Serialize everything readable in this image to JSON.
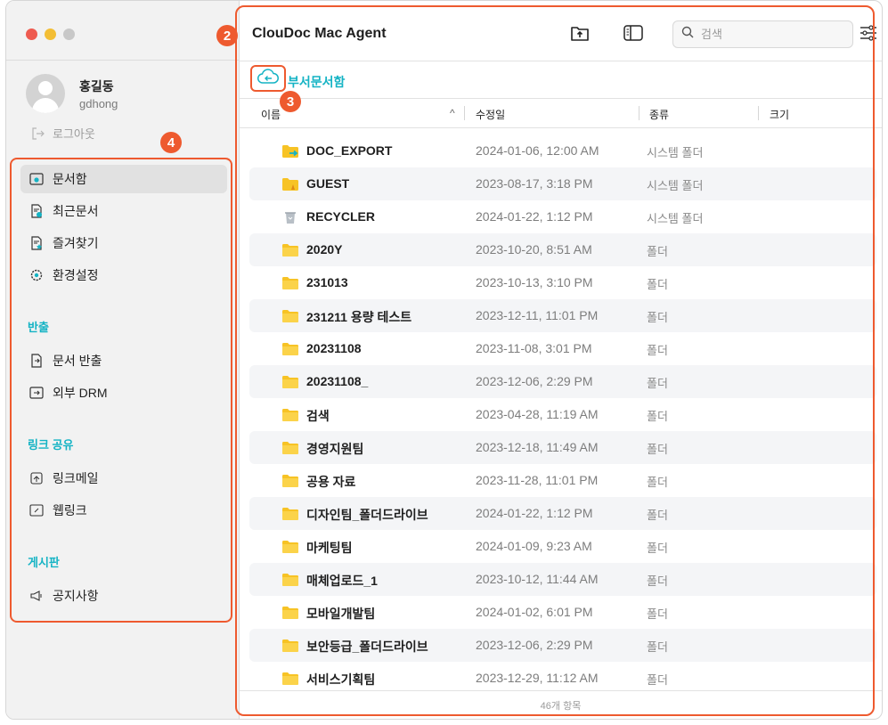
{
  "window": {
    "title": "ClouDoc Mac Agent"
  },
  "sidebar": {
    "user_name": "홍길동",
    "user_id": "gdhong",
    "logout_label": "로그아웃",
    "items": [
      {
        "label": "문서함",
        "icon": "folder-box-icon",
        "active": true
      },
      {
        "label": "최근문서",
        "icon": "recent-doc-icon"
      },
      {
        "label": "즐겨찾기",
        "icon": "favorite-doc-icon"
      },
      {
        "label": "환경설정",
        "icon": "gear-icon"
      }
    ],
    "sections": [
      {
        "title": "반출",
        "items": [
          {
            "label": "문서 반출",
            "icon": "export-doc-icon"
          },
          {
            "label": "외부 DRM",
            "icon": "external-drm-icon"
          }
        ]
      },
      {
        "title": "링크 공유",
        "items": [
          {
            "label": "링크메일",
            "icon": "link-mail-icon"
          },
          {
            "label": "웹링크",
            "icon": "web-link-icon"
          }
        ]
      },
      {
        "title": "게시판",
        "items": [
          {
            "label": "공지사항",
            "icon": "megaphone-icon"
          }
        ]
      }
    ]
  },
  "toolbar": {
    "search_placeholder": "검색",
    "upload_icon": "upload-icon",
    "sidebar_toggle_icon": "sidebar-toggle-icon",
    "filter_icon": "filter-sliders-icon"
  },
  "path": {
    "label": "부서문서함",
    "icon": "cloud-back-icon"
  },
  "table": {
    "columns": [
      "이름",
      "수정일",
      "종류",
      "크기"
    ],
    "sort_indicator": "^",
    "rows": [
      {
        "name": "DOC_EXPORT",
        "date": "2024-01-06, 12:00 AM",
        "kind": "시스템 폴더",
        "icon": "export-folder-icon"
      },
      {
        "name": "GUEST",
        "date": "2023-08-17, 3:18 PM",
        "kind": "시스템 폴더",
        "icon": "guest-folder-icon"
      },
      {
        "name": "RECYCLER",
        "date": "2024-01-22, 1:12 PM",
        "kind": "시스템 폴더",
        "icon": "trash-icon"
      },
      {
        "name": "2020Y",
        "date": "2023-10-20, 8:51 AM",
        "kind": "폴더",
        "icon": "folder-icon"
      },
      {
        "name": "231013",
        "date": "2023-10-13, 3:10 PM",
        "kind": "폴더",
        "icon": "folder-icon"
      },
      {
        "name": "231211 용량 테스트",
        "date": "2023-12-11, 11:01 PM",
        "kind": "폴더",
        "icon": "folder-icon"
      },
      {
        "name": "20231108",
        "date": "2023-11-08, 3:01 PM",
        "kind": "폴더",
        "icon": "folder-icon"
      },
      {
        "name": "20231108_",
        "date": "2023-12-06, 2:29 PM",
        "kind": "폴더",
        "icon": "folder-icon"
      },
      {
        "name": "검색",
        "date": "2023-04-28, 11:19 AM",
        "kind": "폴더",
        "icon": "folder-icon"
      },
      {
        "name": "경영지원팀",
        "date": "2023-12-18, 11:49 AM",
        "kind": "폴더",
        "icon": "folder-icon"
      },
      {
        "name": "공용 자료",
        "date": "2023-11-28, 11:01 PM",
        "kind": "폴더",
        "icon": "folder-icon"
      },
      {
        "name": "디자인팀_폴더드라이브",
        "date": "2024-01-22, 1:12 PM",
        "kind": "폴더",
        "icon": "folder-icon"
      },
      {
        "name": "마케팅팀",
        "date": "2024-01-09, 9:23 AM",
        "kind": "폴더",
        "icon": "folder-icon"
      },
      {
        "name": "매체업로드_1",
        "date": "2023-10-12, 11:44 AM",
        "kind": "폴더",
        "icon": "folder-icon"
      },
      {
        "name": "모바일개발팀",
        "date": "2024-01-02, 6:01 PM",
        "kind": "폴더",
        "icon": "folder-icon"
      },
      {
        "name": "보안등급_폴더드라이브",
        "date": "2023-12-06, 2:29 PM",
        "kind": "폴더",
        "icon": "folder-icon"
      },
      {
        "name": "서비스기획팀",
        "date": "2023-12-29, 11:12 AM",
        "kind": "폴더",
        "icon": "folder-icon"
      }
    ]
  },
  "footer": {
    "count_label": "46개 항목"
  },
  "badges": [
    "2",
    "3",
    "4"
  ],
  "colors": {
    "accent": "#14b3c4",
    "highlight": "#ee5a2f",
    "folder": "#f7c325"
  }
}
